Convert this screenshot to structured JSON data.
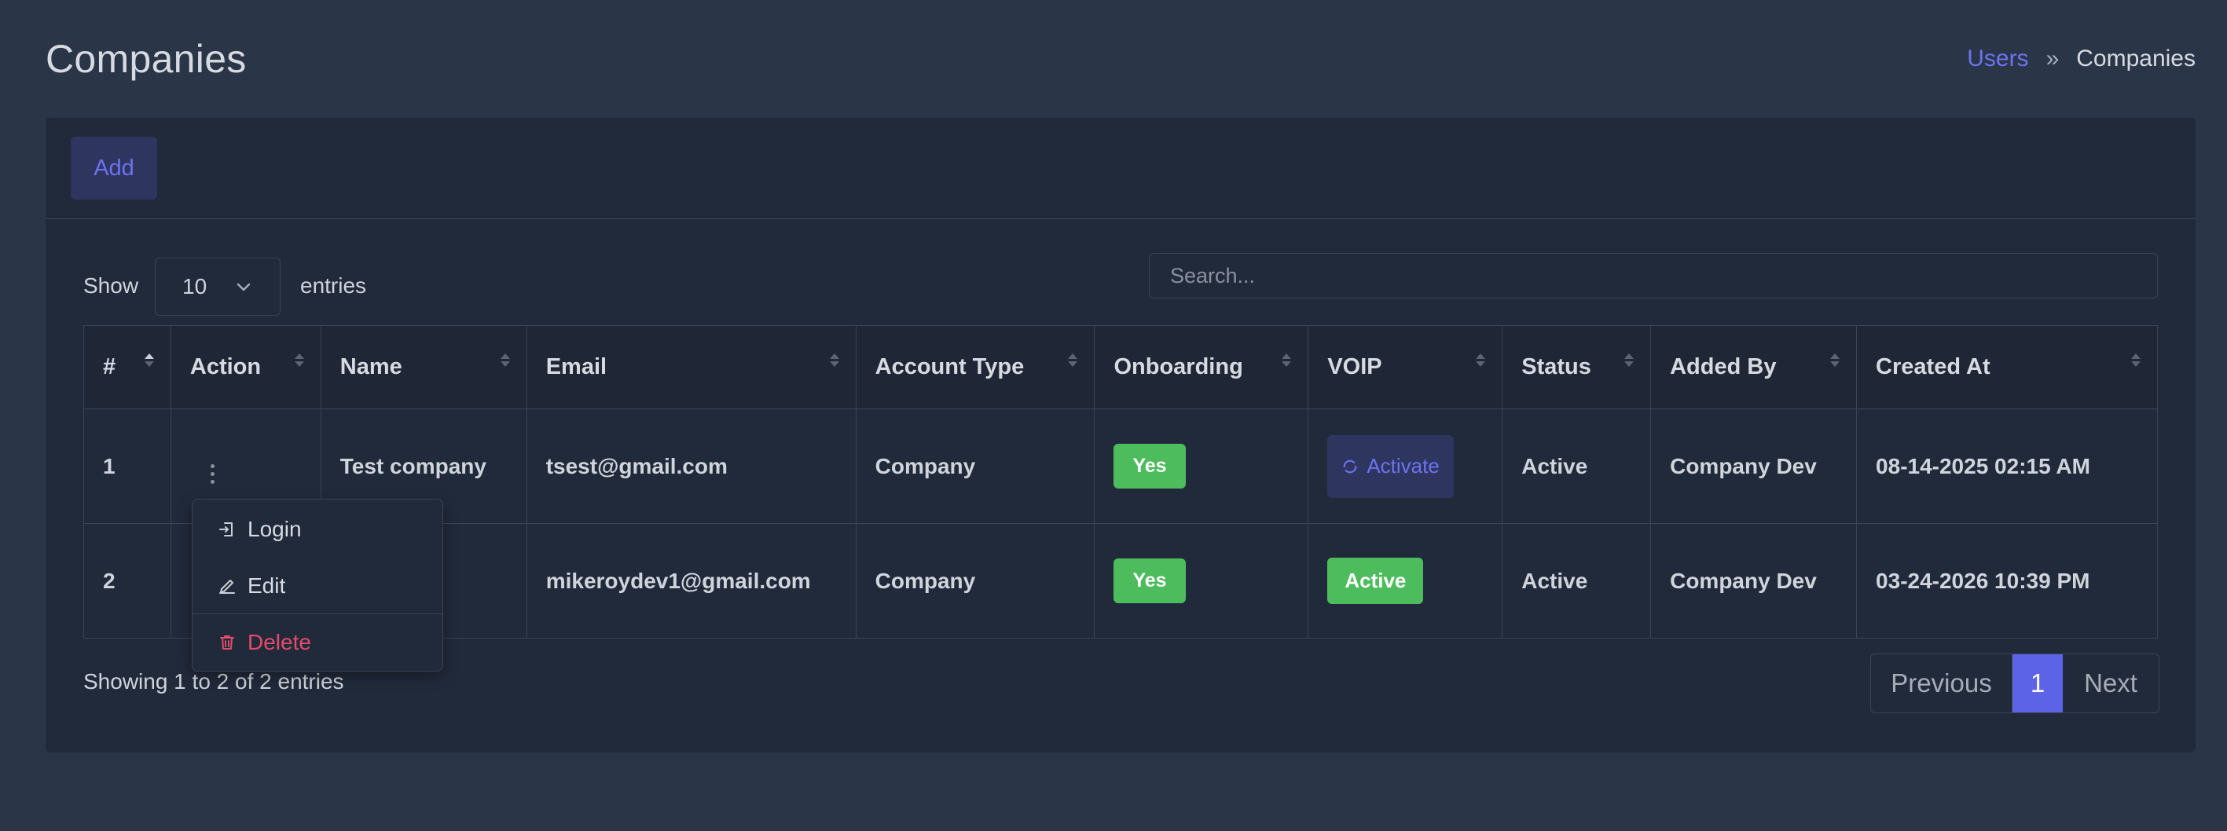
{
  "header": {
    "title": "Companies",
    "breadcrumb": {
      "parent": "Users",
      "separator": "»",
      "current": "Companies"
    }
  },
  "toolbar": {
    "add_label": "Add"
  },
  "controls": {
    "show_label": "Show",
    "page_length": "10",
    "entries_label": "entries",
    "search_placeholder": "Search..."
  },
  "table": {
    "columns": [
      "#",
      "Action",
      "Name",
      "Email",
      "Account Type",
      "Onboarding",
      "VOIP",
      "Status",
      "Added By",
      "Created At"
    ],
    "rows": [
      {
        "num": "1",
        "name": "Test company",
        "email": "tsest@gmail.com",
        "account_type": "Company",
        "onboarding": "Yes",
        "voip": "Activate",
        "status": "Active",
        "added_by": "Company Dev",
        "created_at": "08-14-2025 02:15 AM"
      },
      {
        "num": "2",
        "name": "",
        "email": "mikeroydev1@gmail.com",
        "account_type": "Company",
        "onboarding": "Yes",
        "voip": "Active",
        "status": "Active",
        "added_by": "Company Dev",
        "created_at": "03-24-2026 10:39 PM"
      }
    ]
  },
  "action_menu": {
    "login": "Login",
    "edit": "Edit",
    "delete": "Delete"
  },
  "footer": {
    "info": "Showing 1 to 2 of 2 entries",
    "previous": "Previous",
    "page": "1",
    "next": "Next"
  },
  "colors": {
    "accent": "#6d72f0",
    "success": "#4cbc5c",
    "danger": "#e44b6a",
    "background": "#2a3547",
    "card": "#212a3b"
  }
}
